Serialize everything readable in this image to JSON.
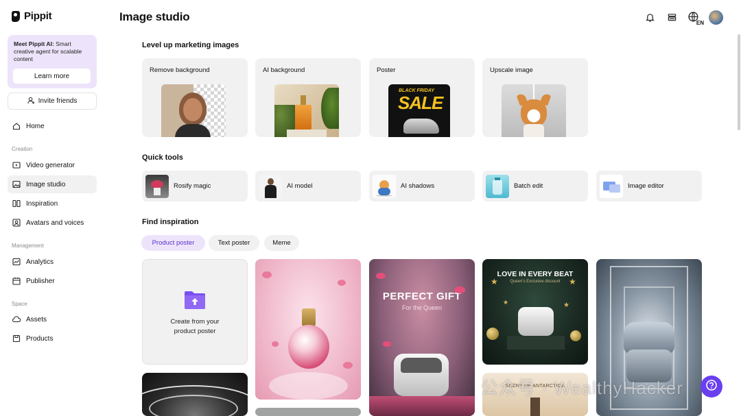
{
  "brand": {
    "name": "Pippit"
  },
  "promo": {
    "title": "Meet Pippit AI:",
    "body": " Smart creative agent for scalable content",
    "button": "Learn more"
  },
  "invite": {
    "label": "Invite friends"
  },
  "nav": {
    "home": "Home",
    "creation_header": "Creation",
    "video_generator": "Video generator",
    "image_studio": "Image studio",
    "inspiration": "Inspiration",
    "avatars_voices": "Avatars and voices",
    "management_header": "Management",
    "analytics": "Analytics",
    "publisher": "Publisher",
    "space_header": "Space",
    "assets": "Assets",
    "products": "Products"
  },
  "header": {
    "title": "Image studio",
    "lang_badge": "EN"
  },
  "level_up": {
    "title": "Level up marketing images",
    "cards": [
      {
        "label": "Remove background"
      },
      {
        "label": "AI background"
      },
      {
        "label": "Poster",
        "poster_text_top": "BLACK FRIDAY",
        "poster_text_main": "SALE"
      },
      {
        "label": "Upscale image"
      }
    ]
  },
  "quick_tools": {
    "title": "Quick tools",
    "items": [
      {
        "label": "Rosify magic"
      },
      {
        "label": "AI model"
      },
      {
        "label": "AI shadows"
      },
      {
        "label": "Batch edit"
      },
      {
        "label": "Image editor"
      }
    ]
  },
  "inspiration": {
    "title": "Find inspiration",
    "tabs": [
      {
        "label": "Product poster",
        "active": true
      },
      {
        "label": "Text poster",
        "active": false
      },
      {
        "label": "Meme",
        "active": false
      }
    ],
    "create_card": {
      "line1": "Create from your",
      "line2": "product poster"
    },
    "posters": [
      {
        "heading": "PERFECT GIFT",
        "sub": "For the Queen"
      },
      {
        "heading": "LOVE IN EVERY BEAT",
        "sub": "Queen's Exclusive discount"
      },
      {
        "heading": "SCENT OF ANTARCTICA"
      }
    ]
  },
  "watermark": "公众号 · WealthyHacker",
  "colors": {
    "accent": "#6a3ff0",
    "chip_active_bg": "#ede4fb",
    "card_bg": "#f1f1f2"
  }
}
